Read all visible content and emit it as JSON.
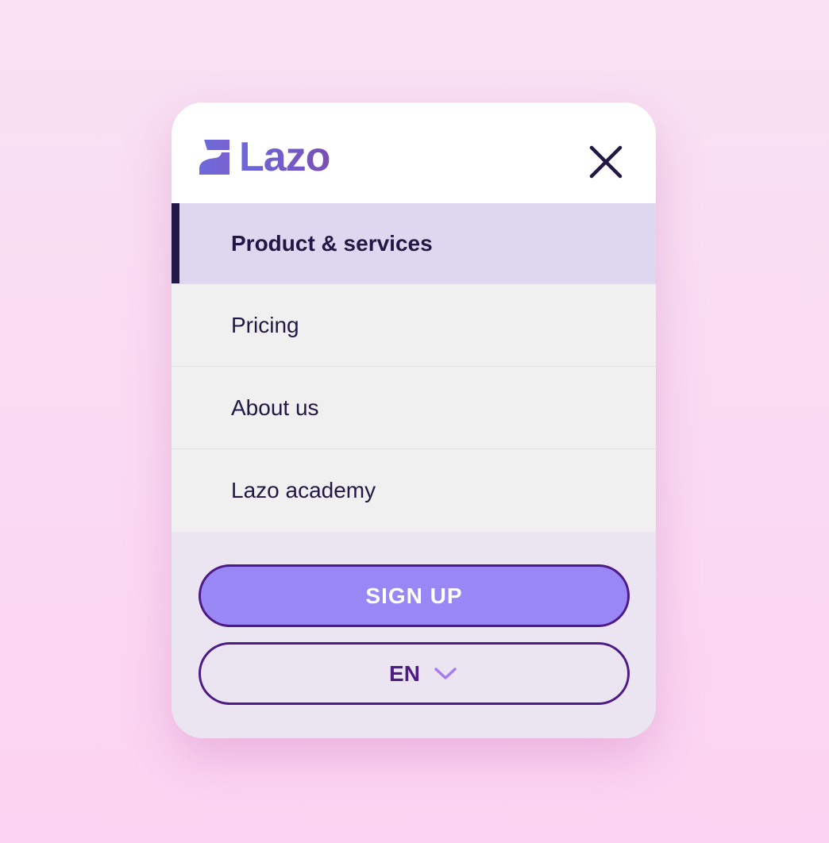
{
  "brand": {
    "name": "Lazo",
    "logo_icon": "lazo-logo-mark",
    "gradient_start": "#6b6adc",
    "gradient_end": "#7a4fb5"
  },
  "header": {
    "close_icon": "close-icon",
    "close_color": "#231845"
  },
  "nav": {
    "items": [
      {
        "label": "Product & services",
        "active": true
      },
      {
        "label": "Pricing",
        "active": false
      },
      {
        "label": "About us",
        "active": false
      },
      {
        "label": "Lazo academy",
        "active": false
      }
    ]
  },
  "actions": {
    "signup_label": "SIGN UP",
    "signup_color": "#9887f5",
    "border_color": "#4d1a86"
  },
  "language": {
    "selected": "EN",
    "dropdown_icon": "chevron-down-icon",
    "dropdown_color": "#a67cf0"
  },
  "colors": {
    "active_bg": "#ddd7f0",
    "item_bg": "#f0f0f1",
    "footer_bg": "#ebe5f1",
    "text_dark": "#231845"
  }
}
